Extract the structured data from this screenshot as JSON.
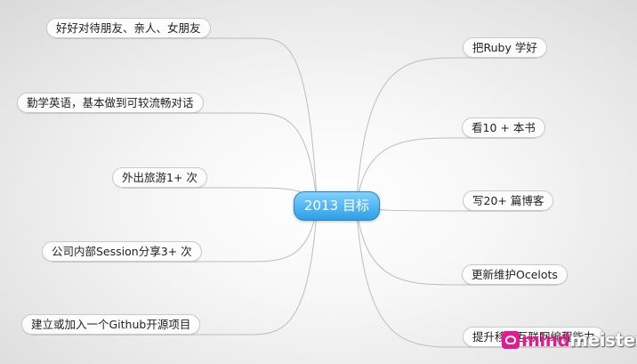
{
  "map": {
    "center": "2013 目标",
    "left": [
      "好好对待朋友、亲人、女朋友",
      "勤学英语，基本做到可较流畅对话",
      "外出旅游1+ 次",
      "公司内部Session分享3+ 次",
      "建立或加入一个Github开源项目"
    ],
    "right": [
      "把Ruby 学好",
      "看10 + 本书",
      "写20+ 篇博客",
      "更新维护Ocelots",
      "提升移动互联网编程能力"
    ]
  },
  "colors": {
    "accent": "#2f9fe6",
    "link": "#bdbdbd",
    "brand_pink": "#e21b8e"
  },
  "logo": {
    "part1": "mind",
    "part2": "meister",
    "icon": "mindmeister-logo-icon"
  }
}
